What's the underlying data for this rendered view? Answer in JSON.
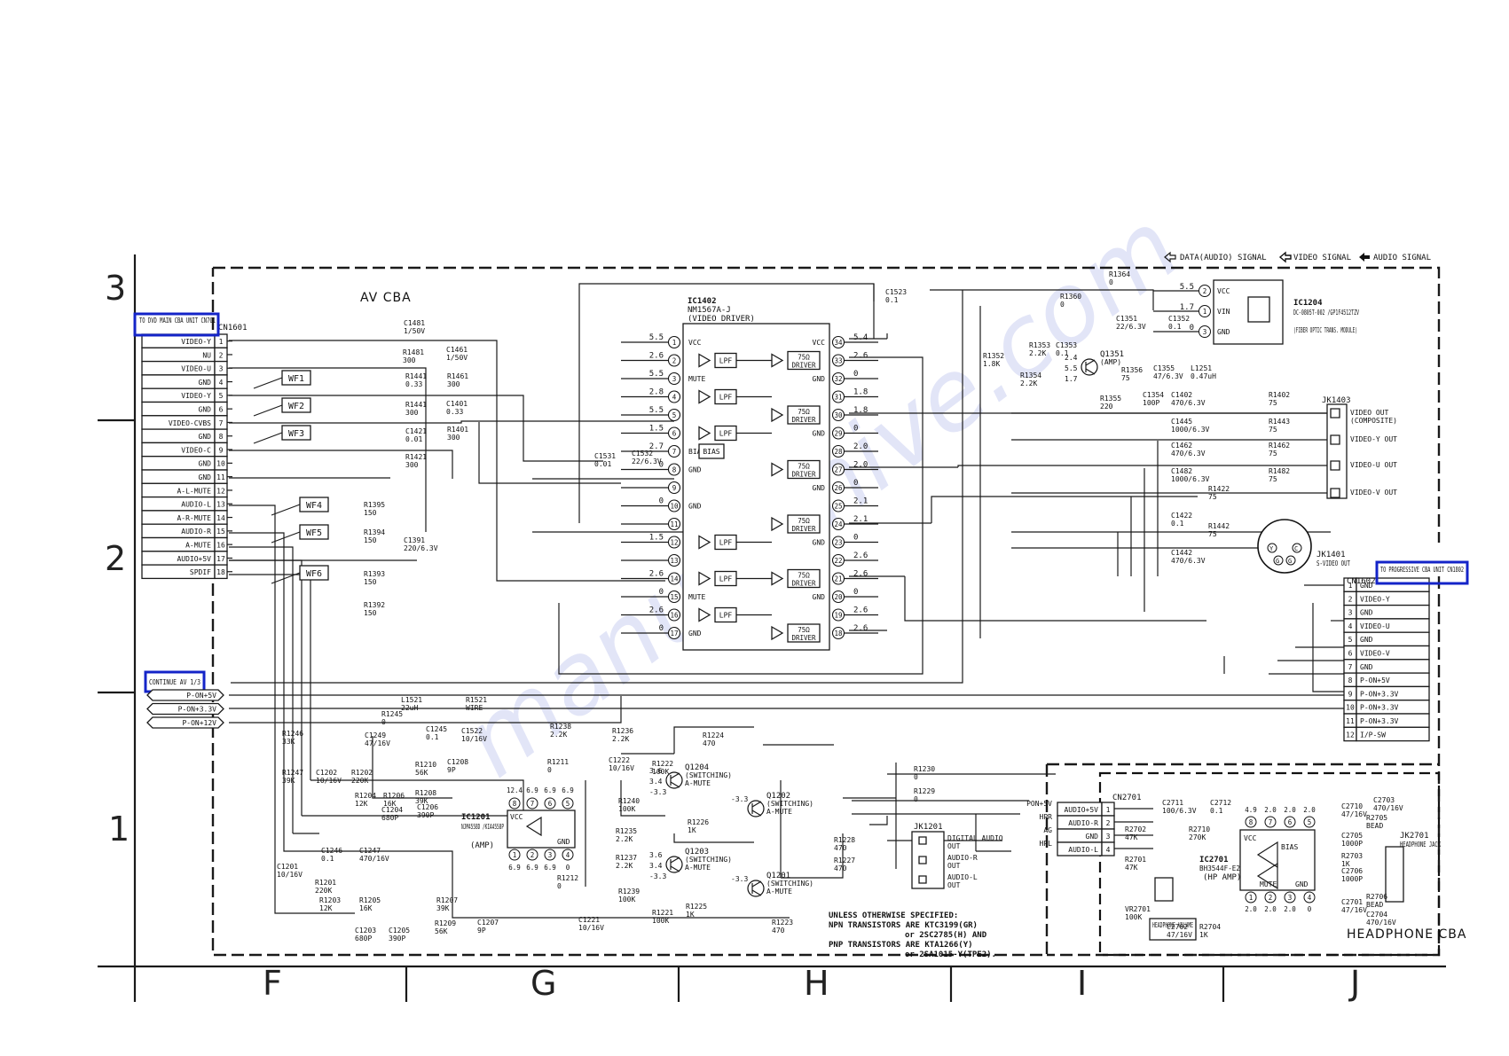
{
  "legend": {
    "data_audio_signal": "DATA(AUDIO) SIGNAL",
    "video_signal": "VIDEO SIGNAL",
    "audio_signal": "AUDIO SIGNAL"
  },
  "grid": {
    "rows": [
      "3",
      "2",
      "1"
    ],
    "cols": [
      "F",
      "G",
      "H",
      "I",
      "J"
    ]
  },
  "board_title": "AV CBA",
  "connectors": {
    "cn1601": {
      "ref": "CN1601",
      "to_label": "TO DVD MAIN CBA UNIT CN701",
      "pins": [
        {
          "n": "1",
          "name": "VIDEO-Y"
        },
        {
          "n": "2",
          "name": "NU"
        },
        {
          "n": "3",
          "name": "VIDEO-U"
        },
        {
          "n": "4",
          "name": "GND"
        },
        {
          "n": "5",
          "name": "VIDEO-Y"
        },
        {
          "n": "6",
          "name": "GND"
        },
        {
          "n": "7",
          "name": "VIDEO-CVBS"
        },
        {
          "n": "8",
          "name": "GND"
        },
        {
          "n": "9",
          "name": "VIDEO-C"
        },
        {
          "n": "10",
          "name": "GND"
        },
        {
          "n": "11",
          "name": "GND"
        },
        {
          "n": "12",
          "name": "A-L-MUTE"
        },
        {
          "n": "13",
          "name": "AUDIO-L"
        },
        {
          "n": "14",
          "name": "A-R-MUTE"
        },
        {
          "n": "15",
          "name": "AUDIO-R"
        },
        {
          "n": "16",
          "name": "A-MUTE"
        },
        {
          "n": "17",
          "name": "AUDIO+5V"
        },
        {
          "n": "18",
          "name": "SPDIF"
        }
      ]
    },
    "cn1602": {
      "ref": "CN1602",
      "to_label": "TO PROGRESSIVE CBA UNIT CN1802",
      "pins": [
        {
          "n": "1",
          "name": "GND"
        },
        {
          "n": "2",
          "name": "VIDEO-Y"
        },
        {
          "n": "3",
          "name": "GND"
        },
        {
          "n": "4",
          "name": "VIDEO-U"
        },
        {
          "n": "5",
          "name": "GND"
        },
        {
          "n": "6",
          "name": "VIDEO-V"
        },
        {
          "n": "7",
          "name": "GND"
        },
        {
          "n": "8",
          "name": "P-ON+5V"
        },
        {
          "n": "9",
          "name": "P-ON+3.3V"
        },
        {
          "n": "10",
          "name": "P-ON+3.3V"
        },
        {
          "n": "11",
          "name": "P-ON+3.3V"
        },
        {
          "n": "12",
          "name": "I/P-SW"
        }
      ]
    },
    "continue": {
      "label": "CONTINUE AV 1/3",
      "rails": [
        "P-ON+5V",
        "P-ON+3.3V",
        "P-ON+12V"
      ]
    },
    "cn2701": {
      "ref": "CN2701",
      "pins": [
        {
          "n": "1",
          "name": "AUDIO+5V"
        },
        {
          "n": "2",
          "name": "AUDIO-R"
        },
        {
          "n": "3",
          "name": "GND"
        },
        {
          "n": "4",
          "name": "AUDIO-L"
        }
      ],
      "left_labels": [
        "PON+5V",
        "HPR",
        "AG",
        "HPL"
      ]
    }
  },
  "waveforms": [
    "WF1",
    "WF2",
    "WF3",
    "WF4",
    "WF5",
    "WF6"
  ],
  "ic1402": {
    "ref": "IC1402",
    "part": "NM1567A-J",
    "func": "(VIDEO DRIVER)",
    "left_pins": [
      {
        "n": "1",
        "name": "VCC",
        "v": "5.5"
      },
      {
        "n": "2",
        "name": "",
        "v": "2.6"
      },
      {
        "n": "3",
        "name": "MUTE",
        "v": "5.5"
      },
      {
        "n": "4",
        "name": "",
        "v": "2.8"
      },
      {
        "n": "5",
        "name": "",
        "v": "5.5"
      },
      {
        "n": "6",
        "name": "",
        "v": "1.5"
      },
      {
        "n": "7",
        "name": "BIAS",
        "v": "2.7"
      },
      {
        "n": "8",
        "name": "GND",
        "v": "0"
      },
      {
        "n": "9",
        "name": "",
        "v": ""
      },
      {
        "n": "10",
        "name": "GND",
        "v": "0"
      },
      {
        "n": "11",
        "name": "",
        "v": ""
      },
      {
        "n": "12",
        "name": "",
        "v": "1.5"
      },
      {
        "n": "13",
        "name": "",
        "v": ""
      },
      {
        "n": "14",
        "name": "",
        "v": "2.6"
      },
      {
        "n": "15",
        "name": "MUTE",
        "v": "0"
      },
      {
        "n": "16",
        "name": "",
        "v": "2.6"
      },
      {
        "n": "17",
        "name": "GND",
        "v": "0"
      }
    ],
    "right_pins": [
      {
        "n": "34",
        "name": "VCC",
        "v": "5.4"
      },
      {
        "n": "33",
        "name": "",
        "v": "2.6"
      },
      {
        "n": "32",
        "name": "GND",
        "v": "0"
      },
      {
        "n": "31",
        "name": "",
        "v": "1.8"
      },
      {
        "n": "30",
        "name": "",
        "v": "1.8"
      },
      {
        "n": "29",
        "name": "GND",
        "v": "0"
      },
      {
        "n": "28",
        "name": "",
        "v": "2.0"
      },
      {
        "n": "27",
        "name": "",
        "v": "2.0"
      },
      {
        "n": "26",
        "name": "GND",
        "v": "0"
      },
      {
        "n": "25",
        "name": "",
        "v": "2.1"
      },
      {
        "n": "24",
        "name": "",
        "v": "2.1"
      },
      {
        "n": "23",
        "name": "GND",
        "v": "0"
      },
      {
        "n": "22",
        "name": "",
        "v": "2.6"
      },
      {
        "n": "21",
        "name": "",
        "v": "2.6"
      },
      {
        "n": "20",
        "name": "GND",
        "v": "0"
      },
      {
        "n": "19",
        "name": "",
        "v": "2.6"
      },
      {
        "n": "18",
        "name": "",
        "v": "2.6"
      }
    ],
    "lpf": "LPF",
    "driver": "75Ω DRIVER",
    "bias": "BIAS"
  },
  "ic1204": {
    "ref": "IC1204",
    "part": "DC-0805T-002 /GP1F4512TZV",
    "func": "(FIBER OPTIC TRANS. MODULE)",
    "pins": [
      {
        "n": "2",
        "name": "VCC",
        "v": "5.5"
      },
      {
        "n": "1",
        "name": "VIN",
        "v": "1.7"
      },
      {
        "n": "3",
        "name": "GND",
        "v": "0"
      }
    ]
  },
  "ic1201": {
    "ref": "IC1201",
    "part": "NJM4558D /KIA4558P",
    "func": "(AMP)",
    "top_pins": [
      "8",
      "7",
      "6",
      "5"
    ],
    "top_v": [
      "12.4",
      "6.9",
      "6.9",
      "6.9"
    ],
    "bottom_pins": [
      "1",
      "2",
      "3",
      "4"
    ],
    "bottom_v": [
      "6.9",
      "6.9",
      "6.9",
      "0"
    ]
  },
  "ic2701": {
    "ref": "IC2701",
    "part": "BH3544F-E2",
    "func": "(HP AMP)",
    "top_pins": [
      "8",
      "7",
      "6",
      "5"
    ],
    "top_v": [
      "4.9",
      "2.0",
      "2.0",
      "2.0"
    ],
    "bottom_pins": [
      "1",
      "2",
      "3",
      "4"
    ],
    "bottom_v": [
      "2.0",
      "2.0",
      "2.0",
      "0"
    ]
  },
  "jacks": {
    "jk1403": {
      "ref": "JK1403",
      "outs": [
        "VIDEO OUT (COMPOSITE)",
        "VIDEO-Y OUT",
        "VIDEO-U OUT",
        "VIDEO-V OUT"
      ]
    },
    "jk1401": {
      "ref": "JK1401",
      "label": "S-VIDEO OUT",
      "pins": [
        "Y",
        "C",
        "G",
        "G"
      ]
    },
    "jk1201": {
      "ref": "JK1201",
      "outs": [
        "DIGITAL AUDIO OUT",
        "AUDIO-R OUT",
        "AUDIO-L OUT"
      ]
    },
    "jk2701": {
      "ref": "JK2701",
      "label": "HEADPHONE JACK"
    }
  },
  "transistors": [
    {
      "ref": "Q1204",
      "func": "(SWITCHING) A-MUTE",
      "v": [
        "3.6",
        "3.4",
        "-3.3"
      ]
    },
    {
      "ref": "Q1202",
      "func": "(SWITCHING) A-MUTE",
      "v": [
        "-3.3"
      ]
    },
    {
      "ref": "Q1203",
      "func": "(SWITCHING) A-MUTE",
      "v": [
        "3.6",
        "3.4",
        "-3.3"
      ]
    },
    {
      "ref": "Q1201",
      "func": "(SWITCHING) A-MUTE",
      "v": [
        "-3.3"
      ]
    },
    {
      "ref": "Q1351",
      "func": "(AMP)",
      "v": [
        "2.4",
        "5.5",
        "1.7"
      ]
    }
  ],
  "components": [
    {
      "ref": "R1364",
      "val": "0"
    },
    {
      "ref": "R1360",
      "val": "0"
    },
    {
      "ref": "C1351",
      "val": "22/6.3V"
    },
    {
      "ref": "C1352",
      "val": "0.1"
    },
    {
      "ref": "R1353",
      "val": "2.2K"
    },
    {
      "ref": "C1353",
      "val": "0.1"
    },
    {
      "ref": "R1352",
      "val": "1.8K"
    },
    {
      "ref": "R1354",
      "val": "2.2K"
    },
    {
      "ref": "R1356",
      "val": "75"
    },
    {
      "ref": "C1355",
      "val": "47/6.3V"
    },
    {
      "ref": "L1251",
      "val": "0.47uH"
    },
    {
      "ref": "R1355",
      "val": "220"
    },
    {
      "ref": "C1354",
      "val": "100P"
    },
    {
      "ref": "C1402",
      "val": "470/6.3V"
    },
    {
      "ref": "R1402",
      "val": "75"
    },
    {
      "ref": "C1445",
      "val": "1000/6.3V"
    },
    {
      "ref": "R1443",
      "val": "75"
    },
    {
      "ref": "C1462",
      "val": "470/6.3V"
    },
    {
      "ref": "R1462",
      "val": "75"
    },
    {
      "ref": "C1482",
      "val": "1000/6.3V"
    },
    {
      "ref": "R1482",
      "val": "75"
    },
    {
      "ref": "R1422",
      "val": "75"
    },
    {
      "ref": "C1422",
      "val": "0.1"
    },
    {
      "ref": "R1442",
      "val": "75"
    },
    {
      "ref": "C1442",
      "val": "470/6.3V"
    },
    {
      "ref": "C1523",
      "val": "0.1"
    },
    {
      "ref": "C1481",
      "val": "1/50V"
    },
    {
      "ref": "R1481",
      "val": "300"
    },
    {
      "ref": "C1461",
      "val": "1/50V"
    },
    {
      "ref": "R1441",
      "val": "0.33"
    },
    {
      "ref": "R1441b",
      "val": "300"
    },
    {
      "ref": "R1461",
      "val": "300"
    },
    {
      "ref": "C1401",
      "val": "0.33"
    },
    {
      "ref": "C1421",
      "val": "0.01"
    },
    {
      "ref": "R1401",
      "val": "300"
    },
    {
      "ref": "R1421",
      "val": "300"
    },
    {
      "ref": "C1531",
      "val": "0.01"
    },
    {
      "ref": "C1532",
      "val": "22/6.3V"
    },
    {
      "ref": "R1395",
      "val": "150"
    },
    {
      "ref": "R1394",
      "val": "150"
    },
    {
      "ref": "C1391",
      "val": "220/6.3V"
    },
    {
      "ref": "R1393",
      "val": "150"
    },
    {
      "ref": "R1392",
      "val": "150"
    },
    {
      "ref": "L1521",
      "val": "22uH"
    },
    {
      "ref": "R1521",
      "val": "WIRE"
    },
    {
      "ref": "R1245",
      "val": "0"
    },
    {
      "ref": "R1246",
      "val": "33K"
    },
    {
      "ref": "C1249",
      "val": "47/16V"
    },
    {
      "ref": "C1245",
      "val": "0.1"
    },
    {
      "ref": "C1522",
      "val": "10/16V"
    },
    {
      "ref": "R1247",
      "val": "39K"
    },
    {
      "ref": "C1202",
      "val": "10/16V"
    },
    {
      "ref": "R1202",
      "val": "220K"
    },
    {
      "ref": "R1210",
      "val": "56K"
    },
    {
      "ref": "C1208",
      "val": "9P"
    },
    {
      "ref": "R1204",
      "val": "12K"
    },
    {
      "ref": "R1206",
      "val": "16K"
    },
    {
      "ref": "R1208",
      "val": "39K"
    },
    {
      "ref": "C1204",
      "val": "680P"
    },
    {
      "ref": "C1206",
      "val": "390P"
    },
    {
      "ref": "R1238",
      "val": "2.2K"
    },
    {
      "ref": "R1236",
      "val": "2.2K"
    },
    {
      "ref": "R1211",
      "val": "0"
    },
    {
      "ref": "C1222",
      "val": "10/16V"
    },
    {
      "ref": "R1222",
      "val": "100K"
    },
    {
      "ref": "R1224",
      "val": "470"
    },
    {
      "ref": "R1240",
      "val": "100K"
    },
    {
      "ref": "R1226",
      "val": "1K"
    },
    {
      "ref": "R1235",
      "val": "2.2K"
    },
    {
      "ref": "R1237",
      "val": "2.2K"
    },
    {
      "ref": "R1239",
      "val": "100K"
    },
    {
      "ref": "R1221",
      "val": "100K"
    },
    {
      "ref": "R1225",
      "val": "1K"
    },
    {
      "ref": "R1223",
      "val": "470"
    },
    {
      "ref": "C1221",
      "val": "10/16V"
    },
    {
      "ref": "R1212",
      "val": "0"
    },
    {
      "ref": "C1246",
      "val": "0.1"
    },
    {
      "ref": "C1247",
      "val": "470/16V"
    },
    {
      "ref": "C1201",
      "val": "10/16V"
    },
    {
      "ref": "R1201",
      "val": "220K"
    },
    {
      "ref": "R1203",
      "val": "12K"
    },
    {
      "ref": "R1205",
      "val": "16K"
    },
    {
      "ref": "R1207",
      "val": "39K"
    },
    {
      "ref": "C1203",
      "val": "680P"
    },
    {
      "ref": "C1205",
      "val": "390P"
    },
    {
      "ref": "R1209",
      "val": "56K"
    },
    {
      "ref": "C1207",
      "val": "9P"
    },
    {
      "ref": "R1230",
      "val": "0"
    },
    {
      "ref": "R1229",
      "val": "0"
    },
    {
      "ref": "R1228",
      "val": "470"
    },
    {
      "ref": "R1227",
      "val": "470"
    },
    {
      "ref": "C2711",
      "val": "100/6.3V"
    },
    {
      "ref": "C2712",
      "val": "0.1"
    },
    {
      "ref": "R2702",
      "val": "47K"
    },
    {
      "ref": "R2710",
      "val": "270K"
    },
    {
      "ref": "R2701",
      "val": "47K"
    },
    {
      "ref": "VR2701",
      "val": "100K"
    },
    {
      "ref": "C2702",
      "val": "47/16V"
    },
    {
      "ref": "R2704",
      "val": "1K"
    },
    {
      "ref": "C2710",
      "val": "47/16V"
    },
    {
      "ref": "C2703",
      "val": "470/16V"
    },
    {
      "ref": "R2705",
      "val": "BEAD"
    },
    {
      "ref": "C2705",
      "val": "1000P"
    },
    {
      "ref": "R2703",
      "val": "1K"
    },
    {
      "ref": "C2706",
      "val": "1000P"
    },
    {
      "ref": "C2701",
      "val": "47/16V"
    },
    {
      "ref": "R2706",
      "val": "BEAD"
    },
    {
      "ref": "C2704",
      "val": "470/16V"
    }
  ],
  "headphone_volume": "HEADPHONE VOLUME",
  "headphone_cba": "HEADPHONE CBA",
  "notes": {
    "line1": "UNLESS OTHERWISE SPECIFIED:",
    "line2": "NPN TRANSISTORS ARE KTC3199(GR)",
    "line3": "or 2SC2785(H) AND",
    "line4": "PNP TRANSISTORS ARE KTA1266(Y)",
    "line5": "or 2SA1015-Y(TPE2)."
  },
  "watermark": "manualshive.com",
  "colors": {
    "highlight": "#1424c8",
    "watermark": "#c9cdf2"
  }
}
